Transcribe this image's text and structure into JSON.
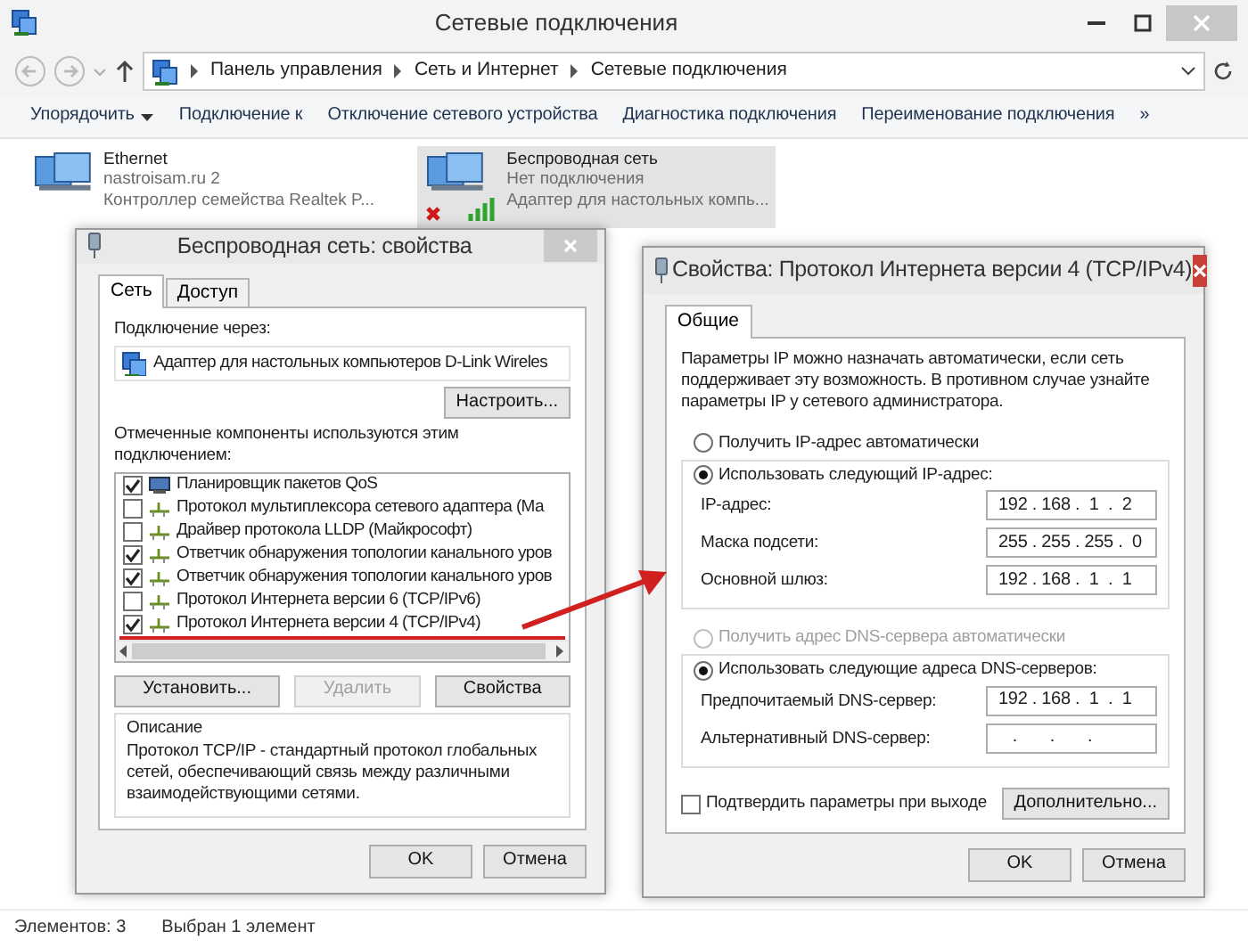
{
  "window": {
    "title": "Сетевые подключения"
  },
  "address_bar": {
    "path": [
      "Панель управления",
      "Сеть и Интернет",
      "Сетевые подключения"
    ]
  },
  "toolbar": {
    "items": [
      {
        "label": "Упорядочить",
        "dropdown": true
      },
      {
        "label": "Подключение к",
        "dropdown": false
      },
      {
        "label": "Отключение сетевого устройства",
        "dropdown": false
      },
      {
        "label": "Диагностика подключения",
        "dropdown": false
      },
      {
        "label": "Переименование подключения",
        "dropdown": false
      }
    ],
    "more": "»"
  },
  "connections": [
    {
      "name": "Ethernet",
      "network": "nastroisam.ru  2",
      "adapter": "Контроллер семейства Realtek P...",
      "selected": false,
      "connected": true
    },
    {
      "name": "Беспроводная сеть",
      "network": "Нет подключения",
      "adapter": "Адаптер для настольных компь...",
      "selected": true,
      "connected": false
    }
  ],
  "status_bar": [
    "Элементов: 3",
    "Выбран 1 элемент"
  ],
  "properties_dialog": {
    "title": "Беспроводная сеть: свойства",
    "tabs": [
      {
        "label": "Сеть",
        "selected": true
      },
      {
        "label": "Доступ",
        "selected": false
      }
    ],
    "connect_using_label": "Подключение через:",
    "adapter": "Адаптер для настольных компьютеров D-Link Wireles",
    "configure_button": "Настроить...",
    "components_label": "Отмеченные компоненты используются этим подключением:",
    "components": [
      {
        "label": "Планировщик пакетов QoS",
        "checked": true,
        "kind": "service",
        "annotated": false
      },
      {
        "label": "Протокол мультиплексора сетевого адаптера (Ма",
        "checked": false,
        "kind": "protocol",
        "annotated": false
      },
      {
        "label": "Драйвер протокола LLDP (Майкрософт)",
        "checked": false,
        "kind": "protocol",
        "annotated": false
      },
      {
        "label": "Ответчик обнаружения топологии канального уров",
        "checked": true,
        "kind": "protocol",
        "annotated": false
      },
      {
        "label": "Ответчик обнаружения топологии канального уров",
        "checked": true,
        "kind": "protocol",
        "annotated": false
      },
      {
        "label": "Протокол Интернета версии 6 (TCP/IPv6)",
        "checked": false,
        "kind": "protocol",
        "annotated": false
      },
      {
        "label": "Протокол Интернета версии 4 (TCP/IPv4)",
        "checked": true,
        "kind": "protocol",
        "annotated": true
      }
    ],
    "buttons": [
      {
        "label": "Установить...",
        "disabled": false
      },
      {
        "label": "Удалить",
        "disabled": true
      },
      {
        "label": "Свойства",
        "disabled": false
      }
    ],
    "description_label": "Описание",
    "description": "Протокол TCP/IP - стандартный протокол глобальных сетей, обеспечивающий связь между различными взаимодействующими сетями.",
    "footer_buttons": [
      "OK",
      "Отмена"
    ]
  },
  "ipv4_dialog": {
    "title": "Свойства: Протокол Интернета версии 4 (TCP/IPv4)",
    "tabs": [
      {
        "label": "Общие",
        "selected": true
      }
    ],
    "intro": "Параметры IP можно назначать автоматически, если сеть поддерживает эту возможность. В противном случае узнайте параметры IP у сетевого администратора.",
    "ip_mode": [
      {
        "label": "Получить IP-адрес автоматически",
        "selected": false,
        "disabled": false
      },
      {
        "label": "Использовать следующий IP-адрес:",
        "selected": true,
        "disabled": false
      }
    ],
    "ip_fields": [
      {
        "label": "IP-адрес:",
        "value": "192 . 168 .  1  .  2"
      },
      {
        "label": "Маска подсети:",
        "value": "255 . 255 . 255 .  0"
      },
      {
        "label": "Основной шлюз:",
        "value": "192 . 168 .  1  .  1"
      }
    ],
    "dns_mode": [
      {
        "label": "Получить адрес DNS-сервера автоматически",
        "selected": false,
        "disabled": true
      },
      {
        "label": "Использовать следующие адреса DNS-серверов:",
        "selected": true,
        "disabled": false
      }
    ],
    "dns_fields": [
      {
        "label": "Предпочитаемый DNS-сервер:",
        "value": "192 . 168 .  1  .  1"
      },
      {
        "label": "Альтернативный DNS-сервер:",
        "value": "   .       .       ."
      }
    ],
    "validate": {
      "label": "Подтвердить параметры при выходе",
      "checked": false
    },
    "advanced_button": "Дополнительно...",
    "footer_buttons": [
      "OK",
      "Отмена"
    ]
  }
}
